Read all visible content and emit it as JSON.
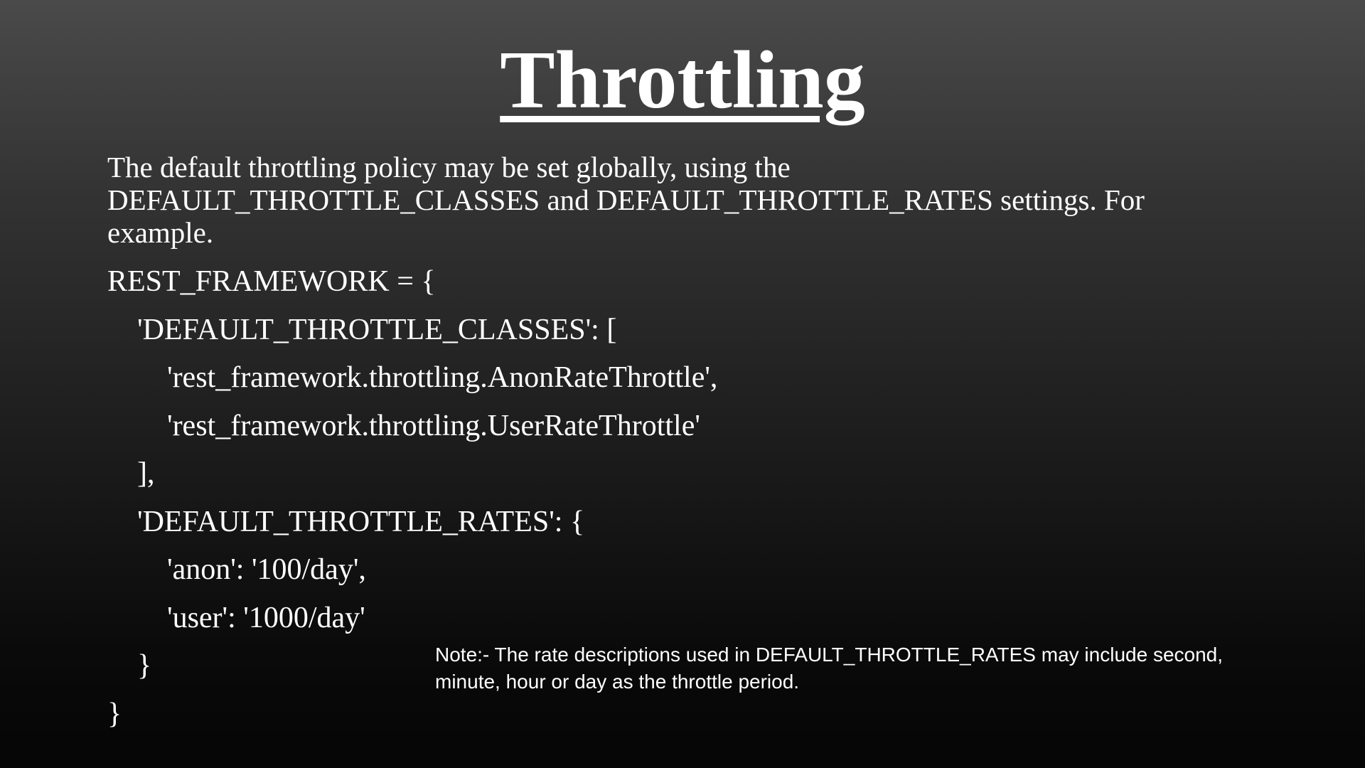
{
  "slide": {
    "title": "Throttling",
    "intro": "The default throttling policy may be set globally, using the DEFAULT_THROTTLE_CLASSES and DEFAULT_THROTTLE_RATES settings. For example.",
    "code_lines": [
      "REST_FRAMEWORK = {",
      "'DEFAULT_THROTTLE_CLASSES': [",
      "'rest_framework.throttling.AnonRateThrottle',",
      "'rest_framework.throttling.UserRateThrottle'",
      "],",
      "'DEFAULT_THROTTLE_RATES': {",
      "'anon': '100/day',",
      "'user': '1000/day'",
      "}",
      "}"
    ],
    "note": "Note:- The rate descriptions used in DEFAULT_THROTTLE_RATES may include second, minute, hour or day as the throttle period."
  }
}
